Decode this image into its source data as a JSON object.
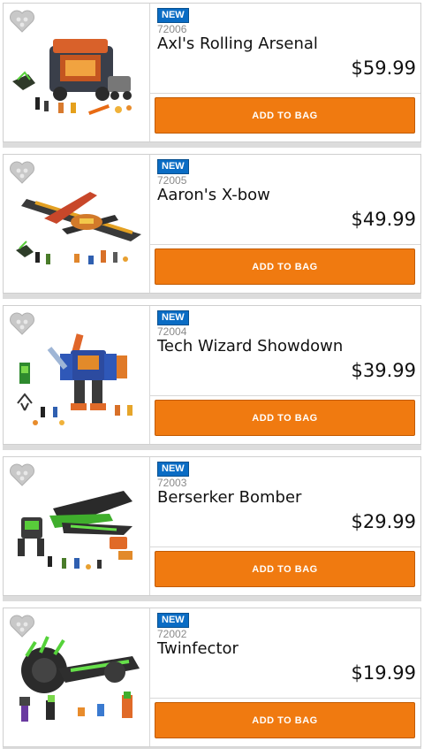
{
  "products": [
    {
      "badge": "NEW",
      "item_no": "72006",
      "name": "Axl's Rolling Arsenal",
      "price": "$59.99",
      "button": "ADD TO BAG",
      "image_icon": "lego-set-axls-rolling-arsenal"
    },
    {
      "badge": "NEW",
      "item_no": "72005",
      "name": "Aaron's X-bow",
      "price": "$49.99",
      "button": "ADD TO BAG",
      "image_icon": "lego-set-aarons-x-bow"
    },
    {
      "badge": "NEW",
      "item_no": "72004",
      "name": "Tech Wizard Showdown",
      "price": "$39.99",
      "button": "ADD TO BAG",
      "image_icon": "lego-set-tech-wizard-showdown"
    },
    {
      "badge": "NEW",
      "item_no": "72003",
      "name": "Berserker Bomber",
      "price": "$29.99",
      "button": "ADD TO BAG",
      "image_icon": "lego-set-berserker-bomber"
    },
    {
      "badge": "NEW",
      "item_no": "72002",
      "name": "Twinfector",
      "price": "$19.99",
      "button": "ADD TO BAG",
      "image_icon": "lego-set-twinfector"
    }
  ],
  "colors": {
    "badge": "#0a6cc4",
    "button": "#f07a10",
    "wishlist_icon": "#c8c8c8"
  }
}
